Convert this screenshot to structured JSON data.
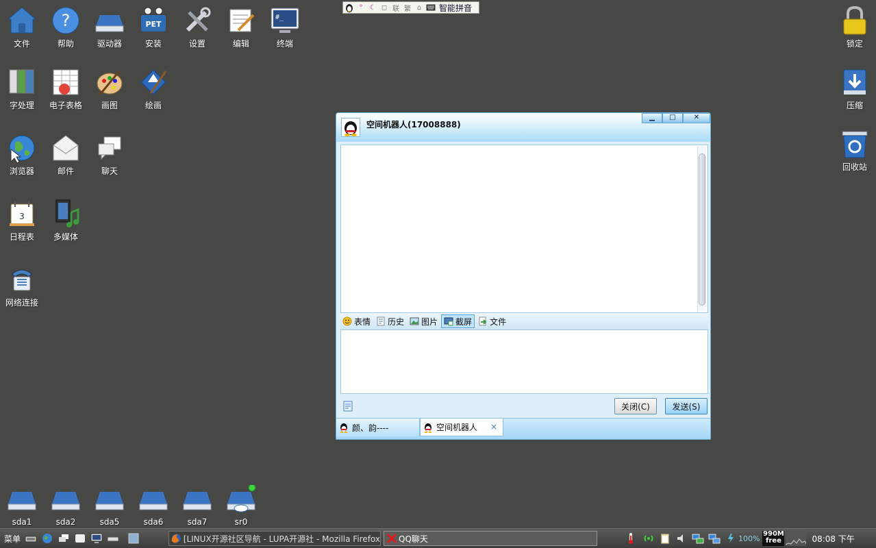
{
  "desktop": {
    "icons": [
      {
        "label": "文件",
        "icon": "file-manager-icon"
      },
      {
        "label": "帮助",
        "icon": "help-icon"
      },
      {
        "label": "驱动器",
        "icon": "drive-icon"
      },
      {
        "label": "安装",
        "icon": "pet-install-icon"
      },
      {
        "label": "设置",
        "icon": "settings-tools-icon"
      },
      {
        "label": "编辑",
        "icon": "text-editor-icon"
      },
      {
        "label": "终端",
        "icon": "terminal-icon"
      },
      {
        "label": "字处理",
        "icon": "word-processor-icon"
      },
      {
        "label": "电子表格",
        "icon": "spreadsheet-icon"
      },
      {
        "label": "画图",
        "icon": "paint-palette-icon"
      },
      {
        "label": "绘画",
        "icon": "draw-icon"
      },
      {
        "label": "浏览器",
        "icon": "browser-globe-icon"
      },
      {
        "label": "邮件",
        "icon": "mail-icon"
      },
      {
        "label": "聊天",
        "icon": "chat-icon"
      },
      {
        "label": "日程表",
        "icon": "calendar-icon"
      },
      {
        "label": "多媒体",
        "icon": "multimedia-icon"
      },
      {
        "label": "网络连接",
        "icon": "network-phone-icon"
      }
    ],
    "calendar_day": "3",
    "right_icons": [
      {
        "label": "锁定",
        "icon": "lock-icon"
      },
      {
        "label": "压缩",
        "icon": "archive-icon"
      },
      {
        "label": "回收站",
        "icon": "trash-icon"
      }
    ],
    "drives": [
      "sda1",
      "sda2",
      "sda5",
      "sda6",
      "sda7",
      "sr0"
    ]
  },
  "ime": {
    "name": "智能拼音",
    "buttons": [
      "penguin-icon",
      "punctuation-icon",
      "moon-icon",
      "half-width-icon",
      "simplified-icon",
      "traditional-icon",
      "lock-icon",
      "keyboard-icon"
    ],
    "glyphs": {
      "simplified": "联",
      "traditional": "繁",
      "lock": "⌂"
    }
  },
  "qq_window": {
    "title": "空间机器人(17008888)",
    "toolbar": [
      {
        "label": "表情",
        "icon": "emoticon-icon",
        "active": false
      },
      {
        "label": "历史",
        "icon": "history-icon",
        "active": false
      },
      {
        "label": "图片",
        "icon": "picture-icon",
        "active": false
      },
      {
        "label": "截屏",
        "icon": "screenshot-icon",
        "active": true
      },
      {
        "label": "文件",
        "icon": "file-send-icon",
        "active": false
      }
    ],
    "close_label": "关闭(C)",
    "send_label": "发送(S)",
    "tabs": [
      {
        "label": "颜、韵----",
        "active": false
      },
      {
        "label": "空间机器人",
        "active": true
      }
    ],
    "tab_close": "×"
  },
  "taskbar": {
    "menu_label": "菜单",
    "tasks": [
      {
        "label": "[LINUX开源社区导航 - LUPA开源社 - Mozilla Firefox",
        "icon": "firefox-icon"
      },
      {
        "label": "QQ聊天",
        "icon": "qq-red-x-icon"
      }
    ],
    "battery_label": "100%",
    "memory": {
      "top": "990M",
      "bottom": "free"
    },
    "clock": "08:08 下午"
  },
  "colors": {
    "desktop_bg": "#474846",
    "window_border": "#6ab0dc",
    "accent": "#5ba3d6"
  }
}
